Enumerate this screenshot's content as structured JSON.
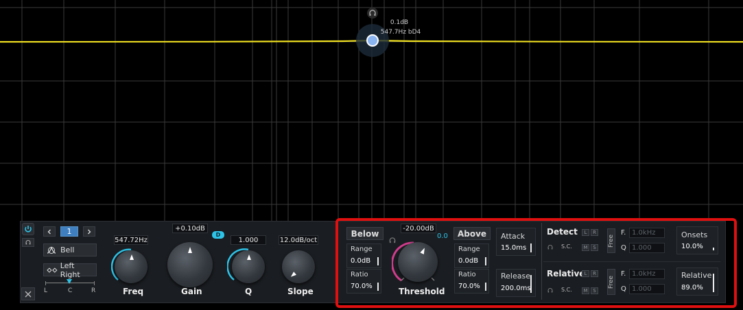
{
  "band": {
    "gain_readout": "0.1dB",
    "freq_note_readout": "547.7Hz bD4",
    "curve_color": "#f0e020",
    "node_color": "#8ab4f0"
  },
  "left": {
    "band_number": "1",
    "shape": "Bell",
    "stereo_mode": "Left Right",
    "pan_labels": [
      "L",
      "C",
      "R"
    ]
  },
  "knobs": {
    "freq": {
      "value": "547.72Hz",
      "label": "Freq"
    },
    "gain": {
      "value": "+0.10dB",
      "label": "Gain",
      "badge": "D"
    },
    "q": {
      "value": "1.000",
      "label": "Q"
    },
    "slope": {
      "value": "12.0dB/oct",
      "label": "Slope"
    }
  },
  "dynamics": {
    "below": {
      "label": "Below",
      "range_label": "Range",
      "range": "0.0dB",
      "ratio_label": "Ratio",
      "ratio": "70.0%"
    },
    "threshold": {
      "value": "-20.00dB",
      "label": "Threshold",
      "delta": "0.0"
    },
    "above": {
      "label": "Above",
      "range_label": "Range",
      "range": "0.0dB",
      "ratio_label": "Ratio",
      "ratio": "70.0%"
    },
    "attack": {
      "label": "Attack",
      "value": "15.0ms"
    },
    "release": {
      "label": "Release",
      "value": "200.0ms"
    }
  },
  "detect": {
    "title": "Detect",
    "l": "L",
    "r": "R",
    "m": "M",
    "s": "S",
    "sc": "S.C.",
    "free": "Free",
    "f_label": "F.",
    "f_value": "1.0kHz",
    "q_label": "Q",
    "q_value": "1.000",
    "onsets_label": "Onsets",
    "onsets_value": "10.0%"
  },
  "relative": {
    "title": "Relative",
    "l": "L",
    "r": "R",
    "m": "M",
    "s": "S",
    "sc": "S.C.",
    "free": "Free",
    "f_label": "F.",
    "f_value": "1.0kHz",
    "q_label": "Q",
    "q_value": "1.000",
    "rel_label": "Relative",
    "rel_value": "89.0%"
  },
  "colors": {
    "accent_cyan": "#2ec4e8",
    "accent_pink": "#d03c8c",
    "highlight_red": "#e01010"
  }
}
